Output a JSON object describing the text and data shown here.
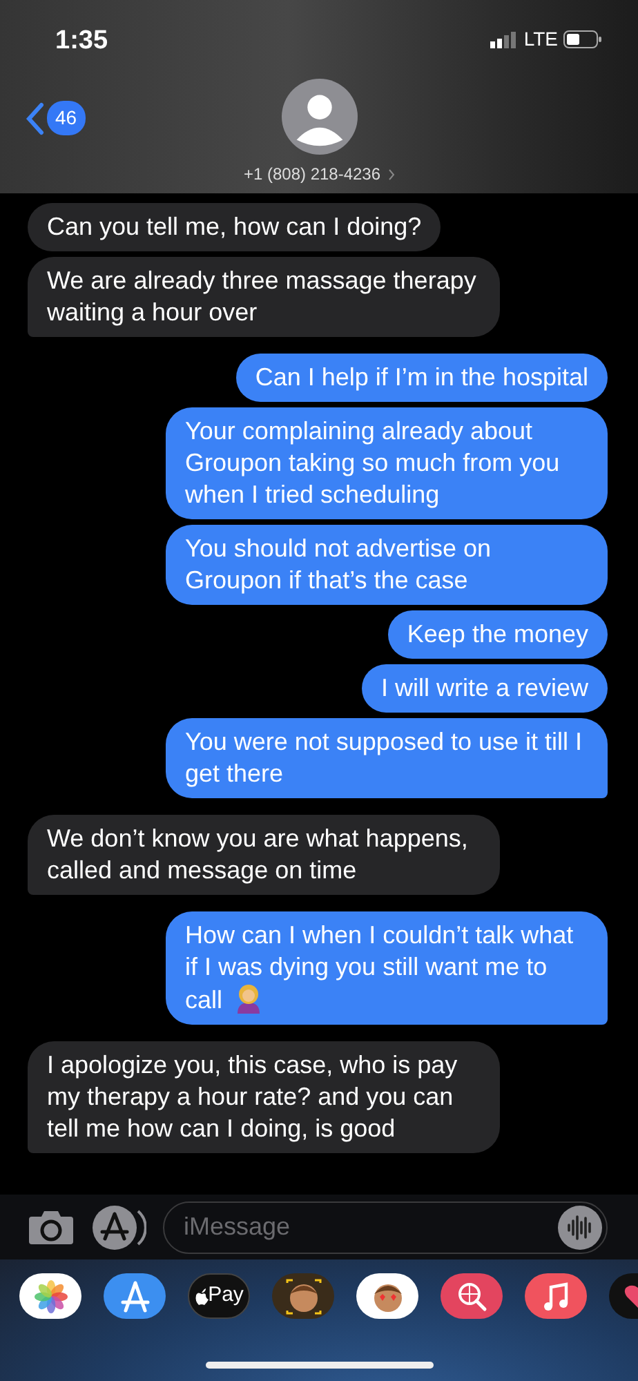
{
  "status_bar": {
    "time": "1:35",
    "network": "LTE"
  },
  "header": {
    "unread_count": "46",
    "contact": "+1 (808) 218-4236"
  },
  "messages": [
    {
      "kind": "received",
      "text": "Can you tell me, how can I doing?"
    },
    {
      "kind": "received",
      "text": "We are already three massage therapy waiting a hour over"
    },
    {
      "kind": "sent",
      "text": "Can I help if I’m in the hospital"
    },
    {
      "kind": "sent",
      "text": "Your complaining already about Groupon taking so much from you when I tried scheduling"
    },
    {
      "kind": "sent",
      "text": "You should not advertise on Groupon if that’s the case"
    },
    {
      "kind": "sent",
      "text": "Keep the money"
    },
    {
      "kind": "sent",
      "text": "I will write a review"
    },
    {
      "kind": "sent",
      "text": "You were not supposed to use it till I get there"
    },
    {
      "kind": "received",
      "text": "We don’t know you are what happens, called and message on time"
    },
    {
      "kind": "sent",
      "text": "How can I when I couldn’t talk what if I was dying you still want me to call",
      "emoji": true
    },
    {
      "kind": "received",
      "text": "I apologize you, this case, who is pay my therapy a hour rate? and you can tell me how can I doing, is good"
    }
  ],
  "composer": {
    "placeholder": "iMessage"
  },
  "app_drawer": [
    {
      "kind": "photos"
    },
    {
      "kind": "appstore"
    },
    {
      "kind": "pay",
      "label": "Pay"
    },
    {
      "kind": "memoji"
    },
    {
      "kind": "memoji-stickers"
    },
    {
      "kind": "search"
    },
    {
      "kind": "music"
    },
    {
      "kind": "hearts"
    }
  ]
}
